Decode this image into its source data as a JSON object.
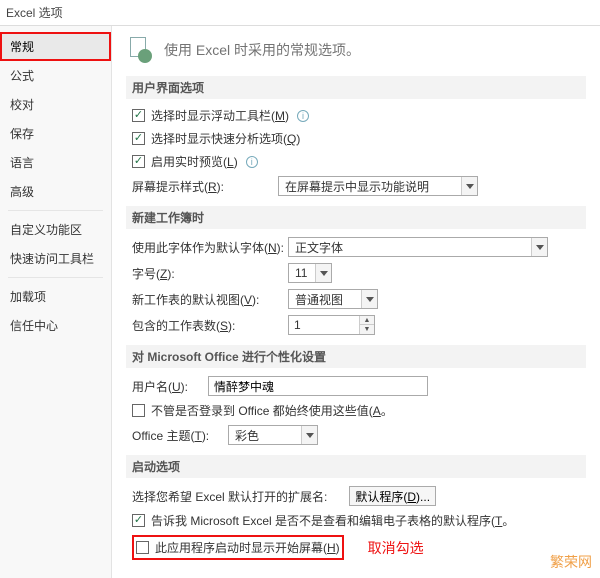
{
  "title": "Excel 选项",
  "sidebar": {
    "items": [
      {
        "label": "常规"
      },
      {
        "label": "公式"
      },
      {
        "label": "校对"
      },
      {
        "label": "保存"
      },
      {
        "label": "语言"
      },
      {
        "label": "高级"
      },
      {
        "label": "自定义功能区"
      },
      {
        "label": "快速访问工具栏"
      },
      {
        "label": "加载项"
      },
      {
        "label": "信任中心"
      }
    ]
  },
  "intro": "使用 Excel 时采用的常规选项。",
  "sections": {
    "ui": {
      "title": "用户界面选项",
      "opt1_pre": "选择时显示浮动工具栏(",
      "opt1_u": "M",
      "opt1_post": ")",
      "opt2_pre": "选择时显示快速分析选项(",
      "opt2_u": "Q",
      "opt2_post": ")",
      "opt3_pre": "启用实时预览(",
      "opt3_u": "L",
      "opt3_post": ")",
      "tip_label_pre": "屏幕提示样式(",
      "tip_label_u": "R",
      "tip_label_post": "):",
      "tip_value": "在屏幕提示中显示功能说明"
    },
    "newwb": {
      "title": "新建工作簿时",
      "font_label_pre": "使用此字体作为默认字体(",
      "font_label_u": "N",
      "font_label_post": "):",
      "font_value": "正文字体",
      "size_label_pre": "字号(",
      "size_label_u": "Z",
      "size_label_post": "):",
      "size_value": "11",
      "view_label_pre": "新工作表的默认视图(",
      "view_label_u": "V",
      "view_label_post": "):",
      "view_value": "普通视图",
      "sheets_label_pre": "包含的工作表数(",
      "sheets_label_u": "S",
      "sheets_label_post": "):",
      "sheets_value": "1"
    },
    "personal": {
      "title": "对 Microsoft Office 进行个性化设置",
      "user_label_pre": "用户名(",
      "user_label_u": "U",
      "user_label_post": "):",
      "user_value": "情醉梦中魂",
      "always_pre": "不管是否登录到 Office 都始终使用这些值(",
      "always_u": "A",
      "always_post": "。",
      "theme_label_pre": "Office 主题(",
      "theme_label_u": "T",
      "theme_label_post": "):",
      "theme_value": "彩色"
    },
    "startup": {
      "title": "启动选项",
      "ext_label": "选择您希望 Excel 默认打开的扩展名:",
      "ext_btn_pre": "默认程序(",
      "ext_btn_u": "D",
      "ext_btn_post": ")...",
      "tell_pre": "告诉我 Microsoft Excel 是否不是查看和编辑电子表格的默认程序(",
      "tell_u": "T",
      "tell_post": "。",
      "start_pre": "此应用程序启动时显示开始屏幕(",
      "start_u": "H",
      "start_post": ")",
      "annotation": "取消勾选"
    }
  },
  "watermark": "繁荣网"
}
